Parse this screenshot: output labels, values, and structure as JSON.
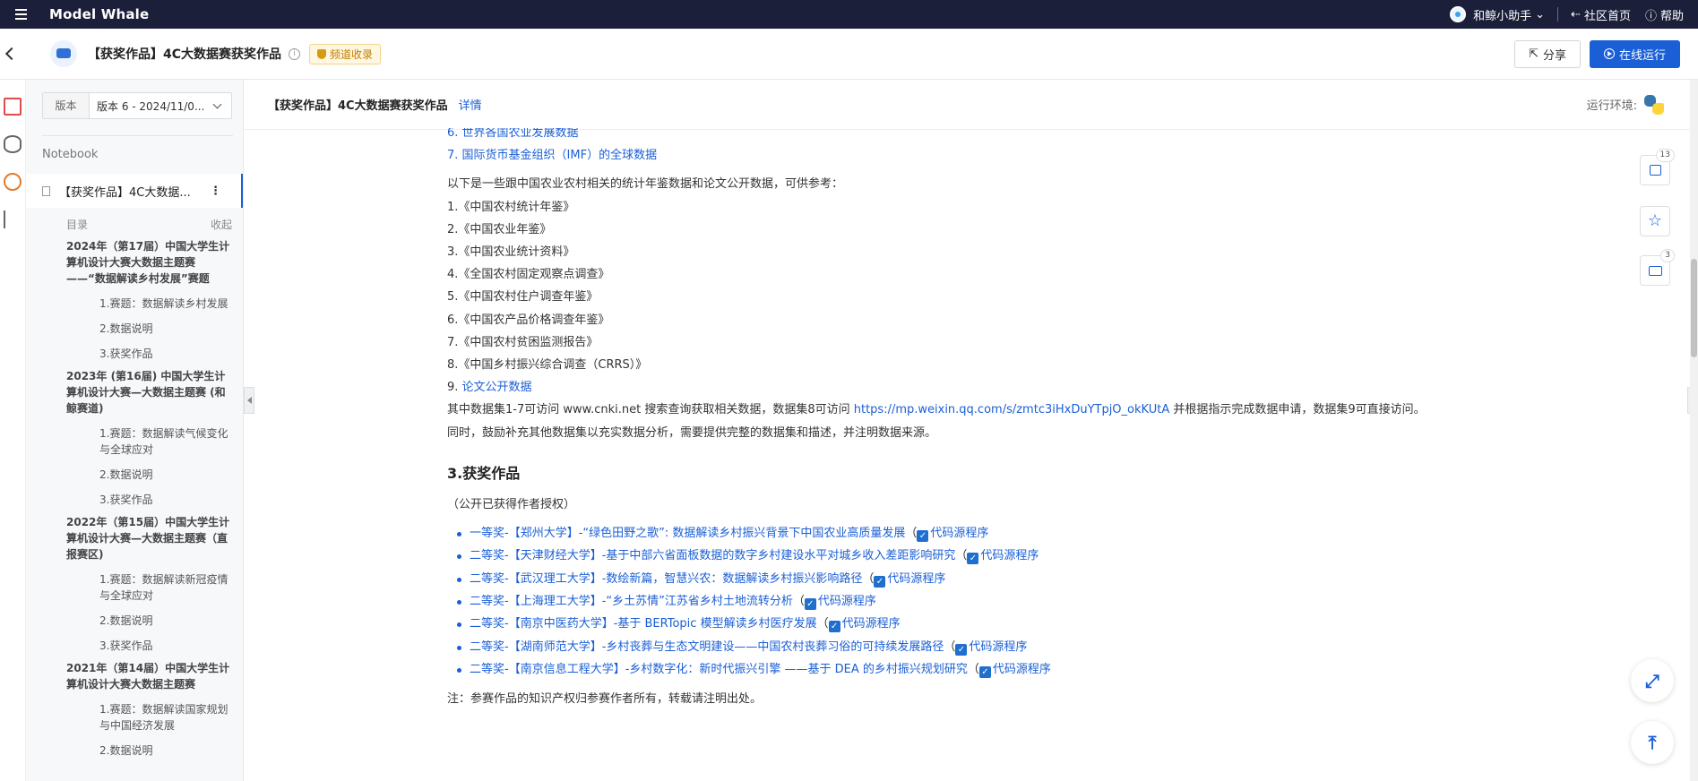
{
  "topbar": {
    "brand": "Model Whale",
    "assistant": "和鲸小助手",
    "community": "社区首页",
    "help": "帮助"
  },
  "header": {
    "title": "【获奖作品】4C大数据赛获奖作品",
    "badge": "频道收录",
    "share": "分享",
    "run": "在线运行"
  },
  "sidebar": {
    "version_label": "版本",
    "version_value": "版本 6 - 2024/11/0...",
    "section": "Notebook",
    "notebook_item": "【获奖作品】4C大数据...",
    "toc_label": "目录",
    "collapse": "收起",
    "toc": [
      {
        "h": "2024年（第17届）中国大学生计算机设计大赛大数据主题赛 ——“数据解读乡村发展”赛题",
        "s": [
          "1.赛题：数据解读乡村发展",
          "2.数据说明",
          "3.获奖作品"
        ]
      },
      {
        "h": "2023年 (第16届) 中国大学生计算机设计大赛—大数据主题赛 (和鲸赛道)",
        "s": [
          "1.赛题：数据解读气候变化与全球应对",
          "2.数据说明",
          "3.获奖作品"
        ]
      },
      {
        "h": "2022年（第15届）中国大学生计算机设计大赛—大数据主题赛（直报赛区)",
        "s": [
          "1.赛题：数据解读新冠疫情与全球应对",
          "2.数据说明",
          "3.获奖作品"
        ]
      },
      {
        "h": "2021年（第14届）中国大学生计算机设计大赛大数据主题赛",
        "s": [
          "1.赛题：数据解读国家规划与中国经济发展",
          "2.数据说明"
        ]
      }
    ]
  },
  "main": {
    "title": "【获奖作品】4C大数据赛获奖作品",
    "detail": "详情",
    "env": "运行环境:",
    "list_top": [
      "6. 世界各国农业发展数据",
      "7. 国际货币基金组织（IMF）的全球数据"
    ],
    "intro": "以下是一些跟中国农业农村相关的统计年鉴数据和论文公开数据，可供参考：",
    "refs": [
      "1.《中国农村统计年鉴》",
      "2.《中国农业年鉴》",
      "3.《中国农业统计资料》",
      "4.《全国农村固定观察点调查》",
      "5.《中国农村住户调查年鉴》",
      "6.《中国农产品价格调查年鉴》",
      "7.《中国农村贫困监测报告》",
      "8.《中国乡村振兴综合调查（CRRS）》"
    ],
    "ref9_num": "9.",
    "ref9_link": "论文公开数据",
    "access_pre": "其中数据集1-7可访问 www.cnki.net 搜索查询获取相关数据，数据集8可访问 ",
    "access_link": "https://mp.weixin.qq.com/s/zmtc3iHxDuYTpjO_okKUtA",
    "access_post": " 并根据指示完成数据申请，数据集9可直接访问。",
    "encourage": "同时，鼓励补充其他数据集以充实数据分析，需要提供完整的数据集和描述，并注明数据来源。",
    "section_title": "3.获奖作品",
    "authorized": "（公开已获得作者授权）",
    "code_label": "代码源程序",
    "awards": [
      "一等奖-【郑州大学】-“绿色田野之歌”: 数据解读乡村振兴背景下中国农业高质量发展",
      "二等奖-【天津财经大学】-基于中部六省面板数据的数字乡村建设水平对城乡收入差距影响研究",
      "二等奖-【武汉理工大学】-数绘新篇，智慧兴农：数据解读乡村振兴影响路径",
      "二等奖-【上海理工大学】-“乡土苏情”江苏省乡村土地流转分析",
      "二等奖-【南京中医药大学】-基于 BERTopic 模型解读乡村医疗发展",
      "二等奖-【湖南师范大学】-乡村丧葬与生态文明建设——中国农村丧葬习俗的可持续发展路径",
      "二等奖-【南京信息工程大学】-乡村数字化：新时代振兴引擎 ——基于 DEA 的乡村振兴规划研究"
    ],
    "note": "注：参赛作品的知识产权归参赛作者所有，转载请注明出处。"
  },
  "toolbar": {
    "likes": "13",
    "comments": "3"
  },
  "colors": {
    "accent": "#1a5fd6",
    "topbar": "#1b1f3a",
    "badge": "#fff7e0"
  },
  "icons": [
    "menu-icon",
    "back-icon",
    "info-icon",
    "shield-icon",
    "share-icon",
    "run-icon",
    "notebook-icon",
    "database-icon",
    "gauge-icon",
    "branch-icon",
    "python-icon",
    "like-icon",
    "star-icon",
    "comment-icon",
    "fullscreen-icon",
    "to-top-icon"
  ]
}
